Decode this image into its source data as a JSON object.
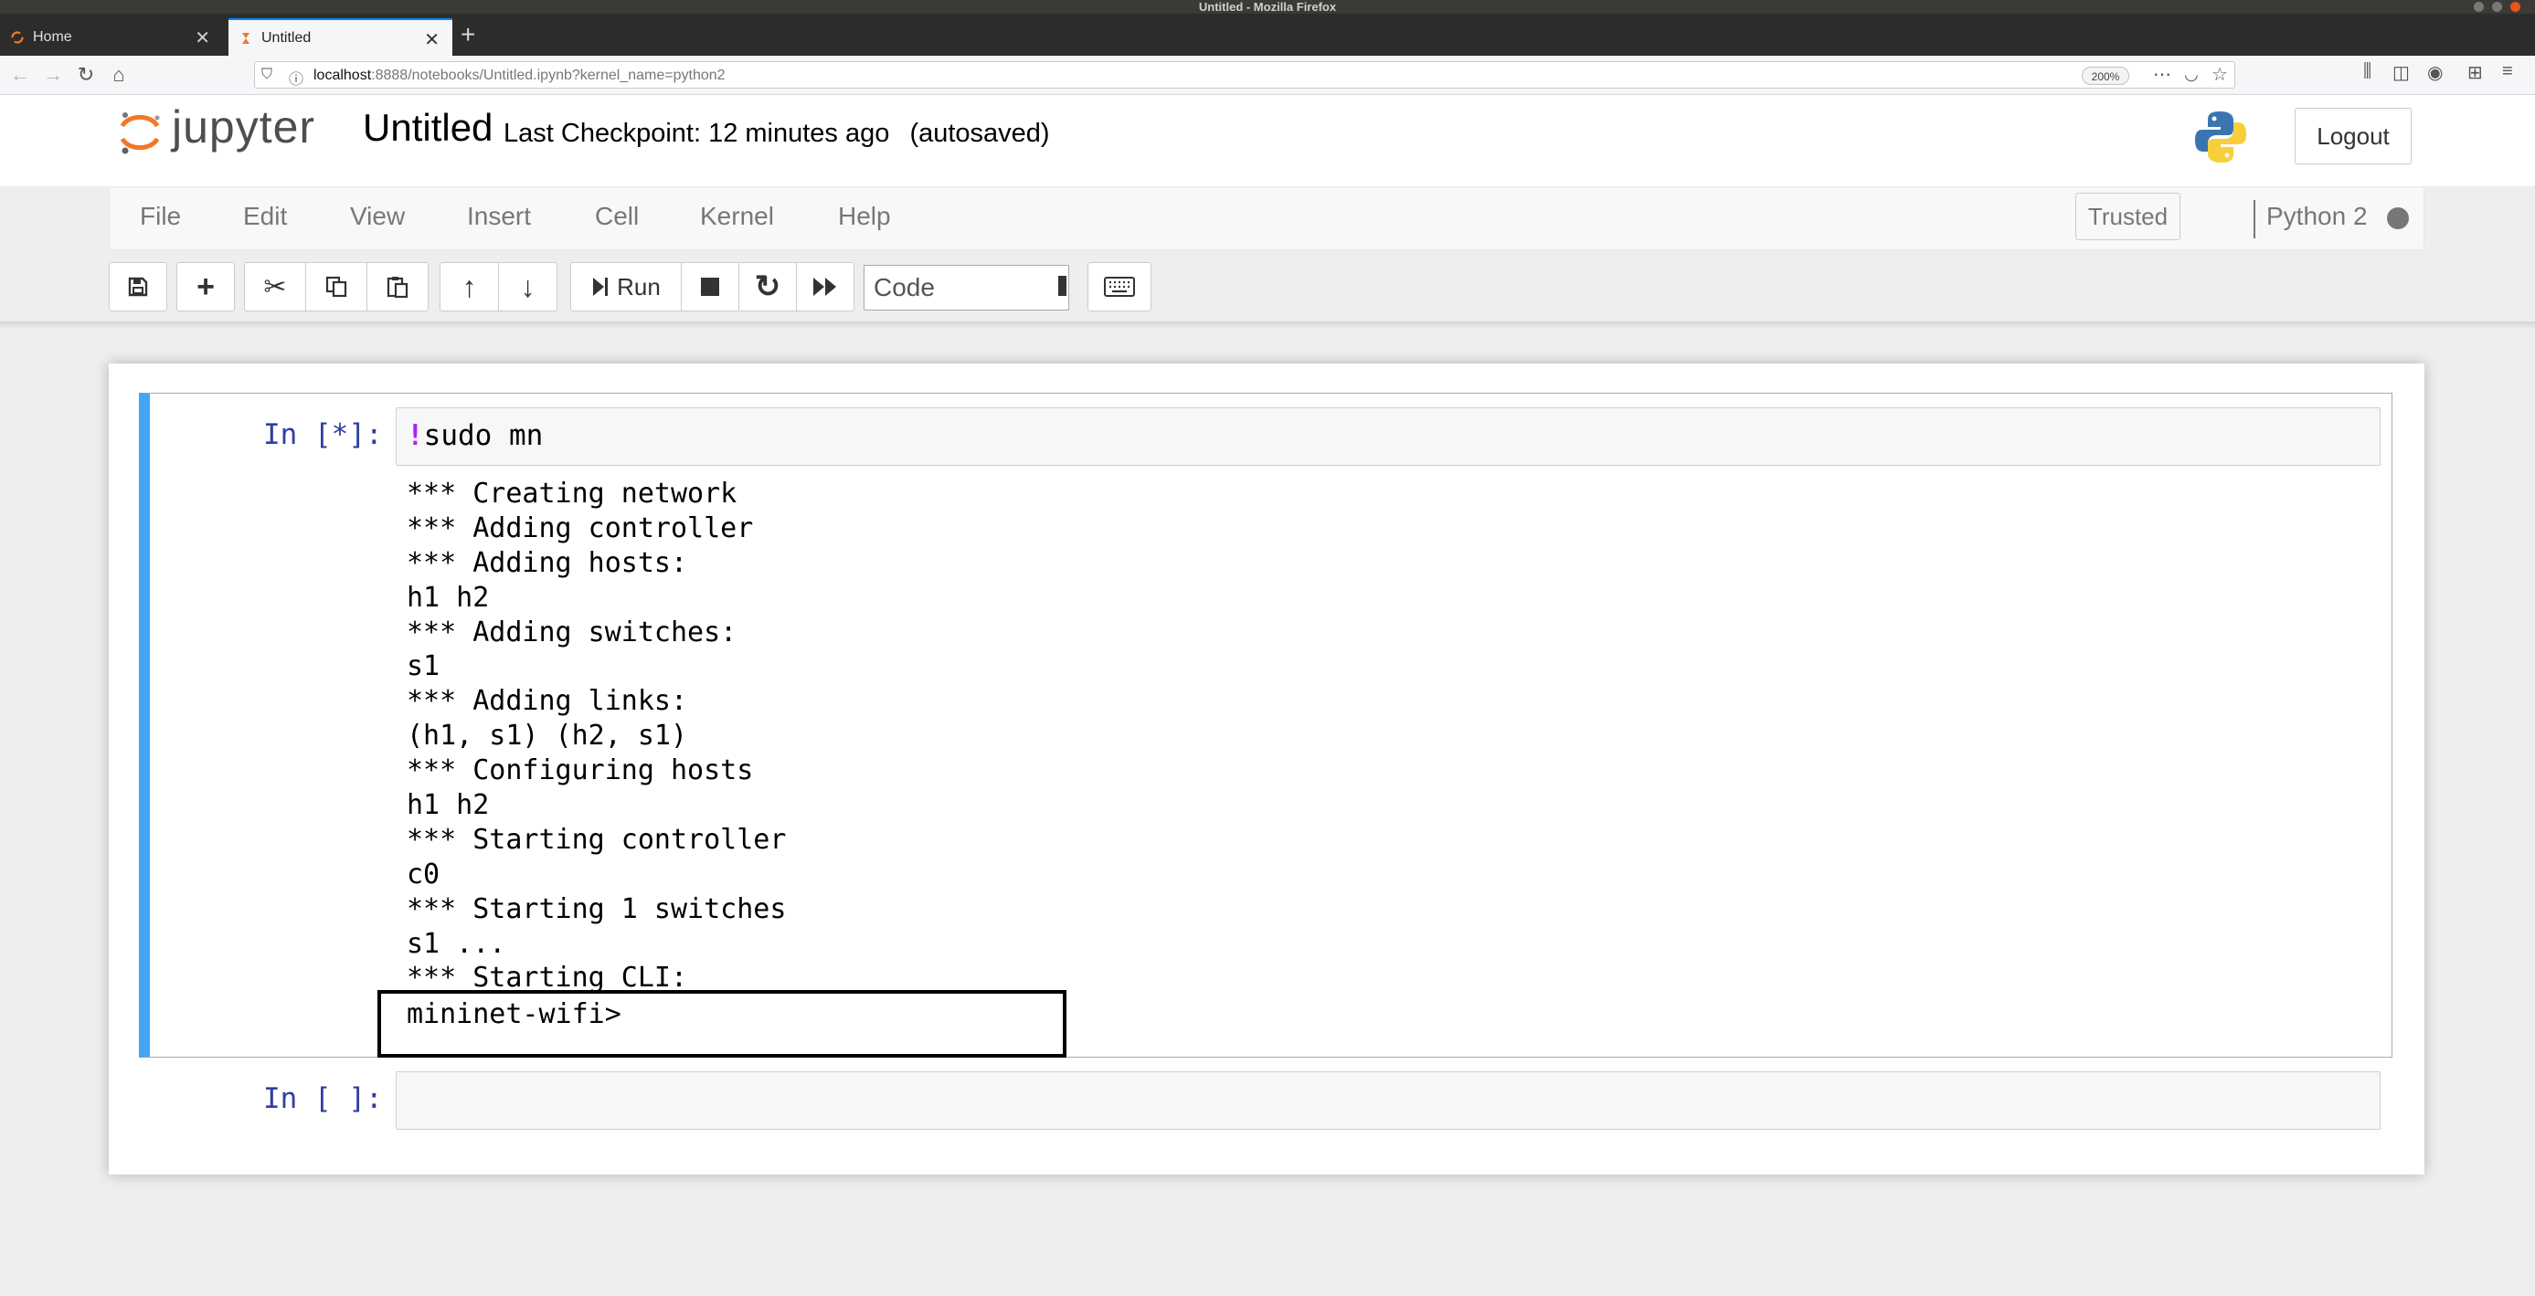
{
  "os": {
    "window_title": "Untitled - Mozilla Firefox"
  },
  "browser": {
    "tabs": [
      {
        "label": "Home",
        "active": false
      },
      {
        "label": "Untitled",
        "active": true
      }
    ],
    "url_host": "localhost",
    "url_rest": ":8888/notebooks/Untitled.ipynb?kernel_name=python2",
    "zoom": "200%"
  },
  "header": {
    "logo_text": "jupyter",
    "notebook_title": "Untitled",
    "checkpoint": "Last Checkpoint: 12 minutes ago",
    "autosave": "(autosaved)",
    "logout_label": "Logout"
  },
  "menubar": {
    "items": [
      "File",
      "Edit",
      "View",
      "Insert",
      "Cell",
      "Kernel",
      "Help"
    ],
    "trusted_label": "Trusted",
    "kernel_name": "Python 2"
  },
  "toolbar": {
    "run_label": "Run",
    "cell_type": "Code",
    "icons": [
      "save-icon",
      "plus-icon",
      "scissors-icon",
      "copy-icon",
      "paste-icon",
      "arrow-up-icon",
      "arrow-down-icon",
      "step-forward-icon",
      "stop-icon",
      "refresh-icon",
      "fast-forward-icon",
      "keyboard-icon"
    ]
  },
  "cells": [
    {
      "prompt": "In [*]:",
      "bang": "!",
      "code": "sudo mn",
      "output": [
        "*** Creating network",
        "*** Adding controller",
        "*** Adding hosts:",
        "h1 h2",
        "*** Adding switches:",
        "s1",
        "*** Adding links:",
        "(h1, s1) (h2, s1)",
        "*** Configuring hosts",
        "h1 h2",
        "*** Starting controller",
        "c0",
        "*** Starting 1 switches",
        "s1 ...",
        "*** Starting CLI:"
      ],
      "cli_prompt": "mininet-wifi>"
    },
    {
      "prompt": "In [ ]:",
      "code": ""
    }
  ],
  "colors": {
    "selected_cell_border": "#42a5f5",
    "prompt": "#303f9f",
    "bang": "#aa22ff",
    "firefox_tab_accent": "#0a84ff"
  }
}
